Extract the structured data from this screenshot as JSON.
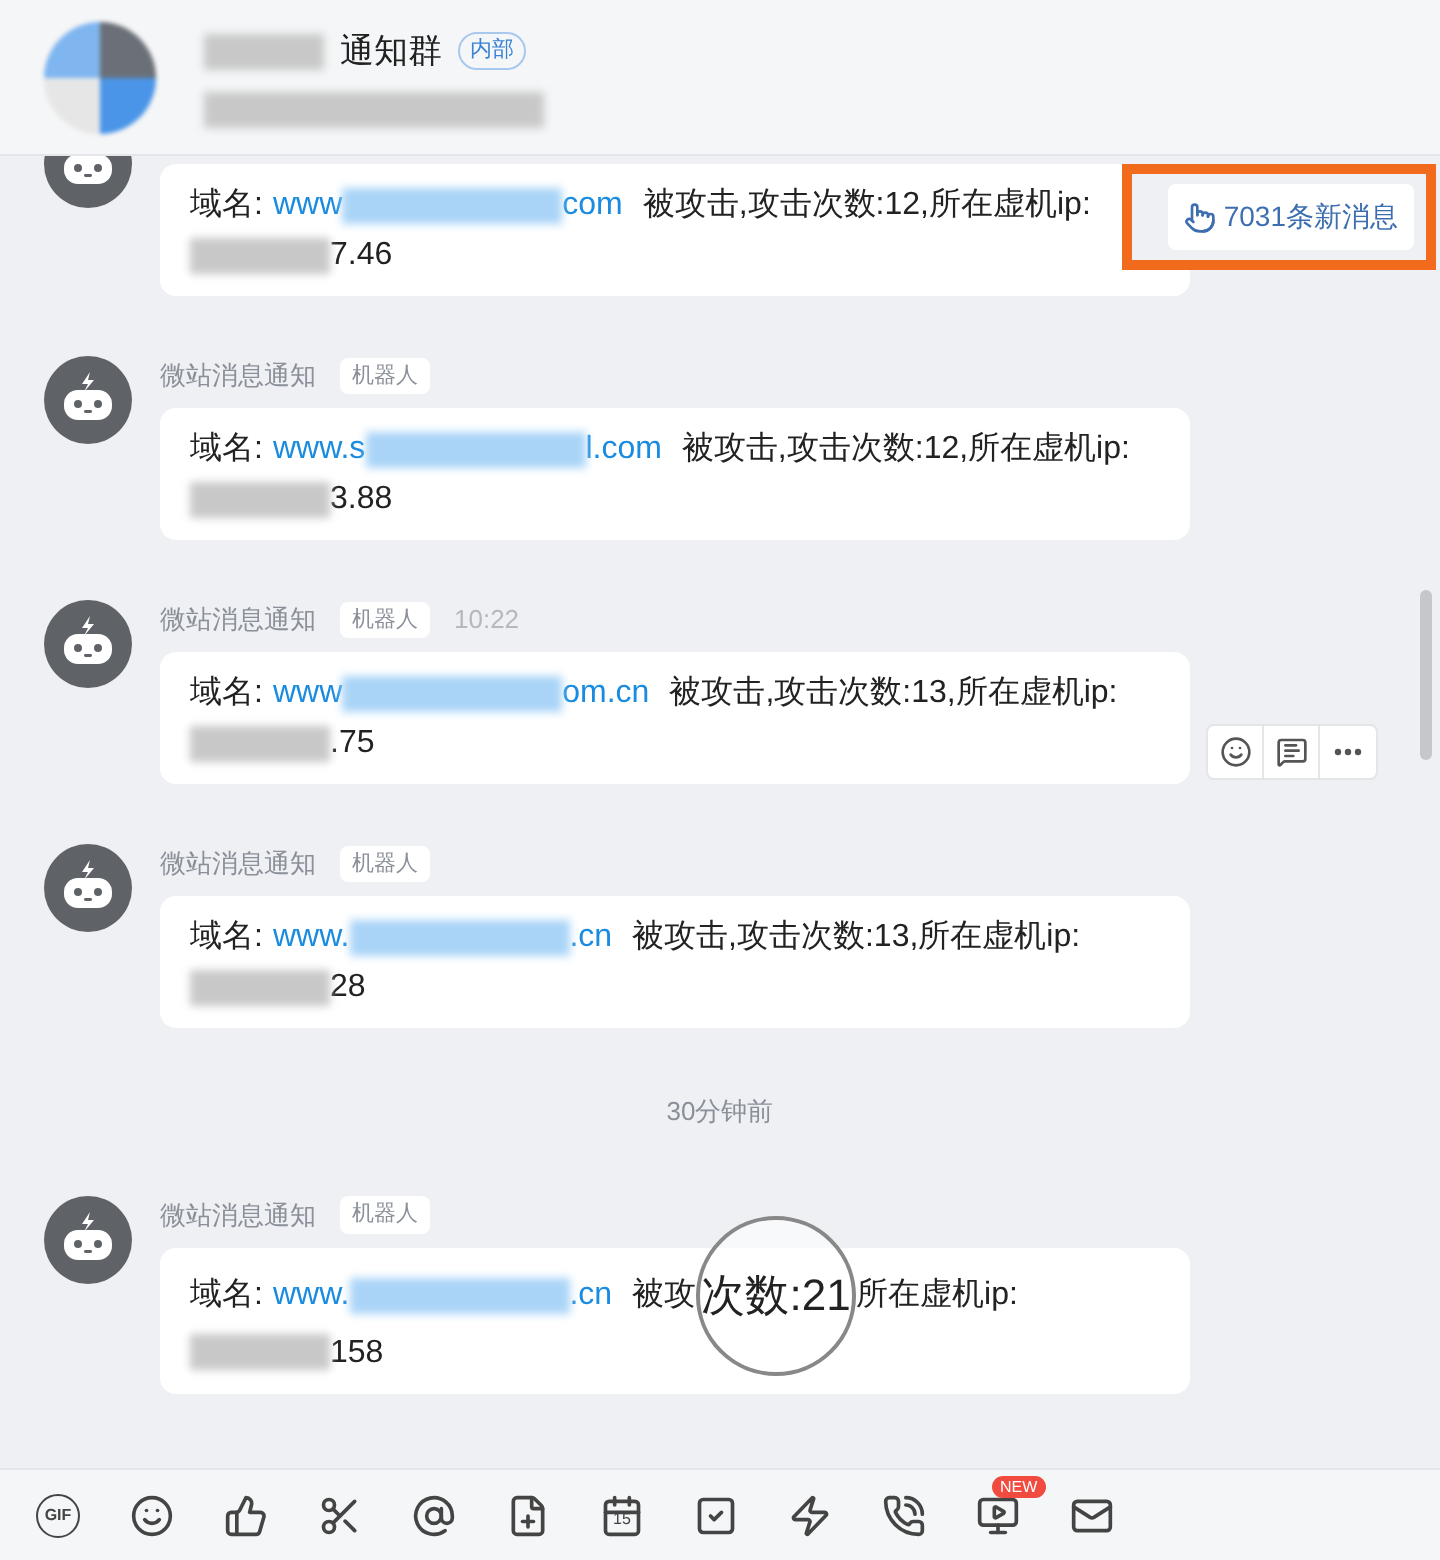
{
  "header": {
    "title": "通知群",
    "badge": "内部"
  },
  "new_messages": {
    "label": "7031条新消息"
  },
  "messages": [
    {
      "prefix": "域名: ",
      "link_start": "www",
      "link_end": "com",
      "text": "被攻击,攻击次数:12,所在虚机ip:",
      "ip_end": "7.46",
      "actions": false
    },
    {
      "sender": "微站消息通知",
      "tag": "机器人",
      "prefix": "域名: ",
      "link_start": "www.s",
      "link_end": "l.com",
      "text": "被攻击,攻击次数:12,所在虚机ip:",
      "ip_end": "3.88",
      "antenna": true,
      "actions": false
    },
    {
      "sender": "微站消息通知",
      "tag": "机器人",
      "time": "10:22",
      "prefix": "域名: ",
      "link_start": "www",
      "link_end": "om.cn",
      "text": "被攻击,攻击次数:13,所在虚机ip:",
      "ip_end": ".75",
      "antenna": true,
      "actions": true
    },
    {
      "sender": "微站消息通知",
      "tag": "机器人",
      "prefix": "域名: ",
      "link_start": "www.",
      "link_end": ".cn",
      "text": "被攻击,攻击次数:13,所在虚机ip:",
      "ip_end": "28",
      "antenna": true,
      "actions": false
    },
    {
      "divider": "30分钟前"
    },
    {
      "sender": "微站消息通知",
      "tag": "机器人",
      "prefix": "域名: ",
      "link_start": "www.",
      "link_end": ".cn",
      "text": "被攻",
      "magnified": "次数:21",
      "text_after": "所在虚机ip:",
      "ip_end": "158",
      "antenna": true,
      "actions": false
    }
  ],
  "toolbar": [
    {
      "kind": "gif",
      "label": "GIF"
    },
    {
      "kind": "emoji"
    },
    {
      "kind": "like"
    },
    {
      "kind": "cut"
    },
    {
      "kind": "mention"
    },
    {
      "kind": "file"
    },
    {
      "kind": "calendar",
      "label": "15"
    },
    {
      "kind": "task"
    },
    {
      "kind": "flash"
    },
    {
      "kind": "call"
    },
    {
      "kind": "live",
      "badge": "NEW"
    },
    {
      "kind": "mail"
    }
  ]
}
